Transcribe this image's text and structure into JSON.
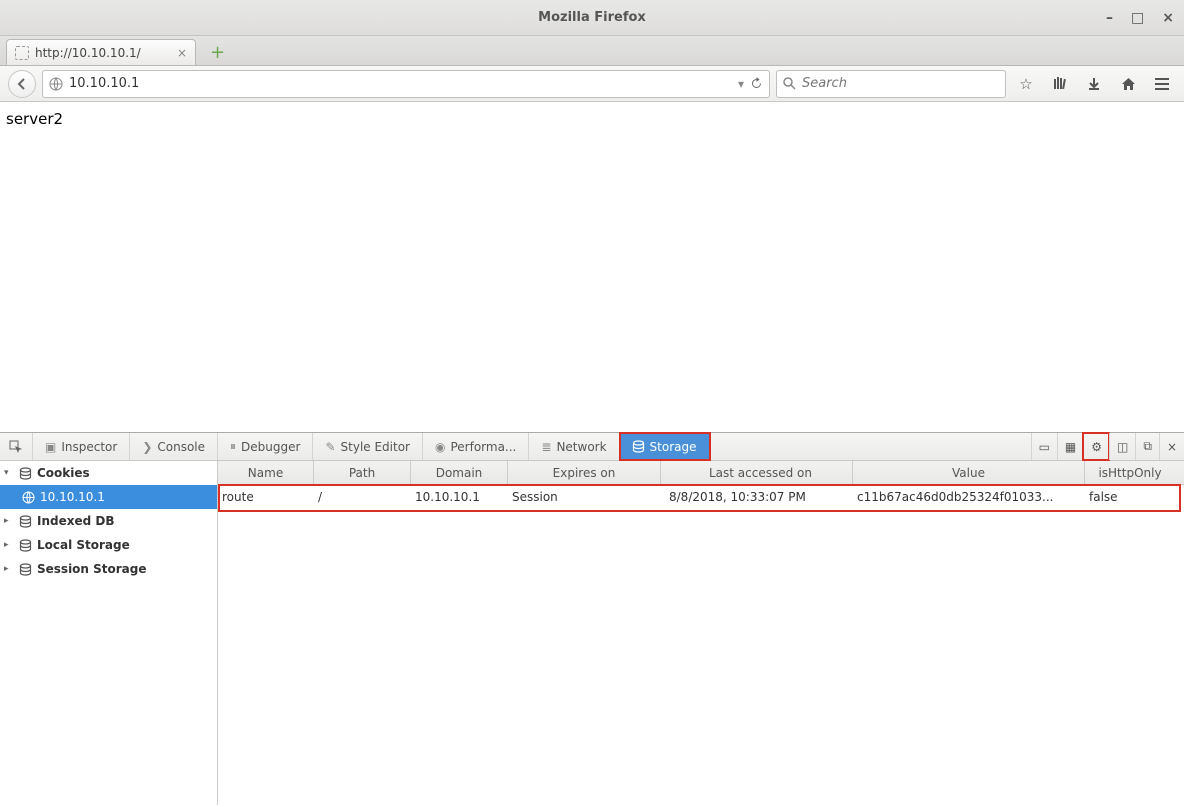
{
  "window": {
    "title": "Mozilla Firefox"
  },
  "tab": {
    "title": "http://10.10.10.1/"
  },
  "url": "10.10.10.1",
  "search_placeholder": "Search",
  "page_body": "server2",
  "devtools": {
    "tabs": {
      "inspector": "Inspector",
      "console": "Console",
      "debugger": "Debugger",
      "style": "Style Editor",
      "performance": "Performa...",
      "network": "Network",
      "storage": "Storage"
    },
    "tree": {
      "cookies": "Cookies",
      "cookies_host": "10.10.10.1",
      "indexed": "Indexed DB",
      "local": "Local Storage",
      "session": "Session Storage"
    },
    "columns": {
      "name": "Name",
      "path": "Path",
      "domain": "Domain",
      "expires": "Expires on",
      "last": "Last accessed on",
      "value": "Value",
      "http": "isHttpOnly"
    },
    "rows": [
      {
        "name": "route",
        "path": "/",
        "domain": "10.10.10.1",
        "expires": "Session",
        "last": "8/8/2018, 10:33:07 PM",
        "value": "c11b67ac46d0db25324f01033...",
        "http": "false"
      }
    ]
  }
}
